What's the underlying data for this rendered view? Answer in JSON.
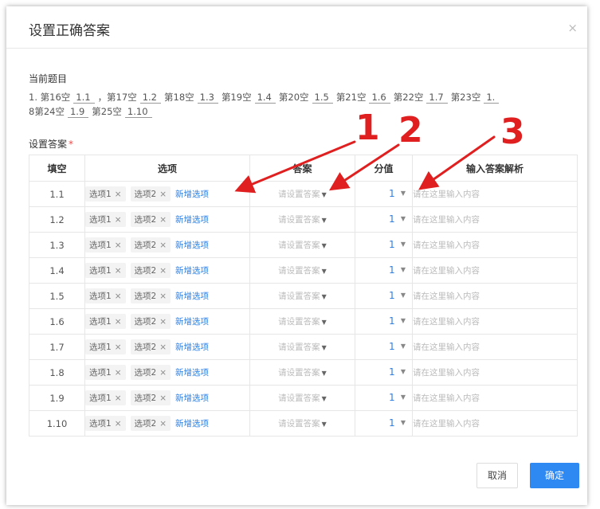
{
  "dialog": {
    "title": "设置正确答案",
    "close_symbol": "×"
  },
  "question": {
    "label": "当前题目",
    "line1_segments": [
      {
        "text": "1. 第16空",
        "blank": "1.1"
      },
      {
        "text": "，第17空",
        "blank": "1.2"
      },
      {
        "text": "第18空",
        "blank": "1.3"
      },
      {
        "text": "第19空",
        "blank": "1.4"
      },
      {
        "text": "第20空",
        "blank": "1.5"
      },
      {
        "text": "第21空",
        "blank": "1.6"
      },
      {
        "text": "第22空",
        "blank": "1.7"
      },
      {
        "text": "第23空",
        "blank": "1."
      }
    ],
    "line2_segments": [
      {
        "text": "8",
        "blank": ""
      },
      {
        "text": "第24空",
        "blank": "1.9"
      },
      {
        "text": "第25空",
        "blank": "1.10"
      }
    ]
  },
  "answers": {
    "label": "设置答案",
    "required_mark": "*",
    "headers": [
      "填空",
      "选项",
      "答案",
      "分值",
      "输入答案解析"
    ],
    "option_tags": [
      "选项1",
      "选项2"
    ],
    "remove_symbol": "×",
    "add_option_label": "新增选项",
    "answer_placeholder": "请设置答案",
    "explain_placeholder": "请在这里输入内容",
    "rows": [
      {
        "blank": "1.1",
        "score": "1"
      },
      {
        "blank": "1.2",
        "score": "1"
      },
      {
        "blank": "1.3",
        "score": "1"
      },
      {
        "blank": "1.4",
        "score": "1"
      },
      {
        "blank": "1.5",
        "score": "1"
      },
      {
        "blank": "1.6",
        "score": "1"
      },
      {
        "blank": "1.7",
        "score": "1"
      },
      {
        "blank": "1.8",
        "score": "1"
      },
      {
        "blank": "1.9",
        "score": "1"
      },
      {
        "blank": "1.10",
        "score": "1"
      }
    ]
  },
  "footer": {
    "cancel_label": "取消",
    "confirm_label": "确定"
  },
  "annotations": {
    "numbers": [
      "1",
      "2",
      "3"
    ],
    "color": "#e02020"
  }
}
